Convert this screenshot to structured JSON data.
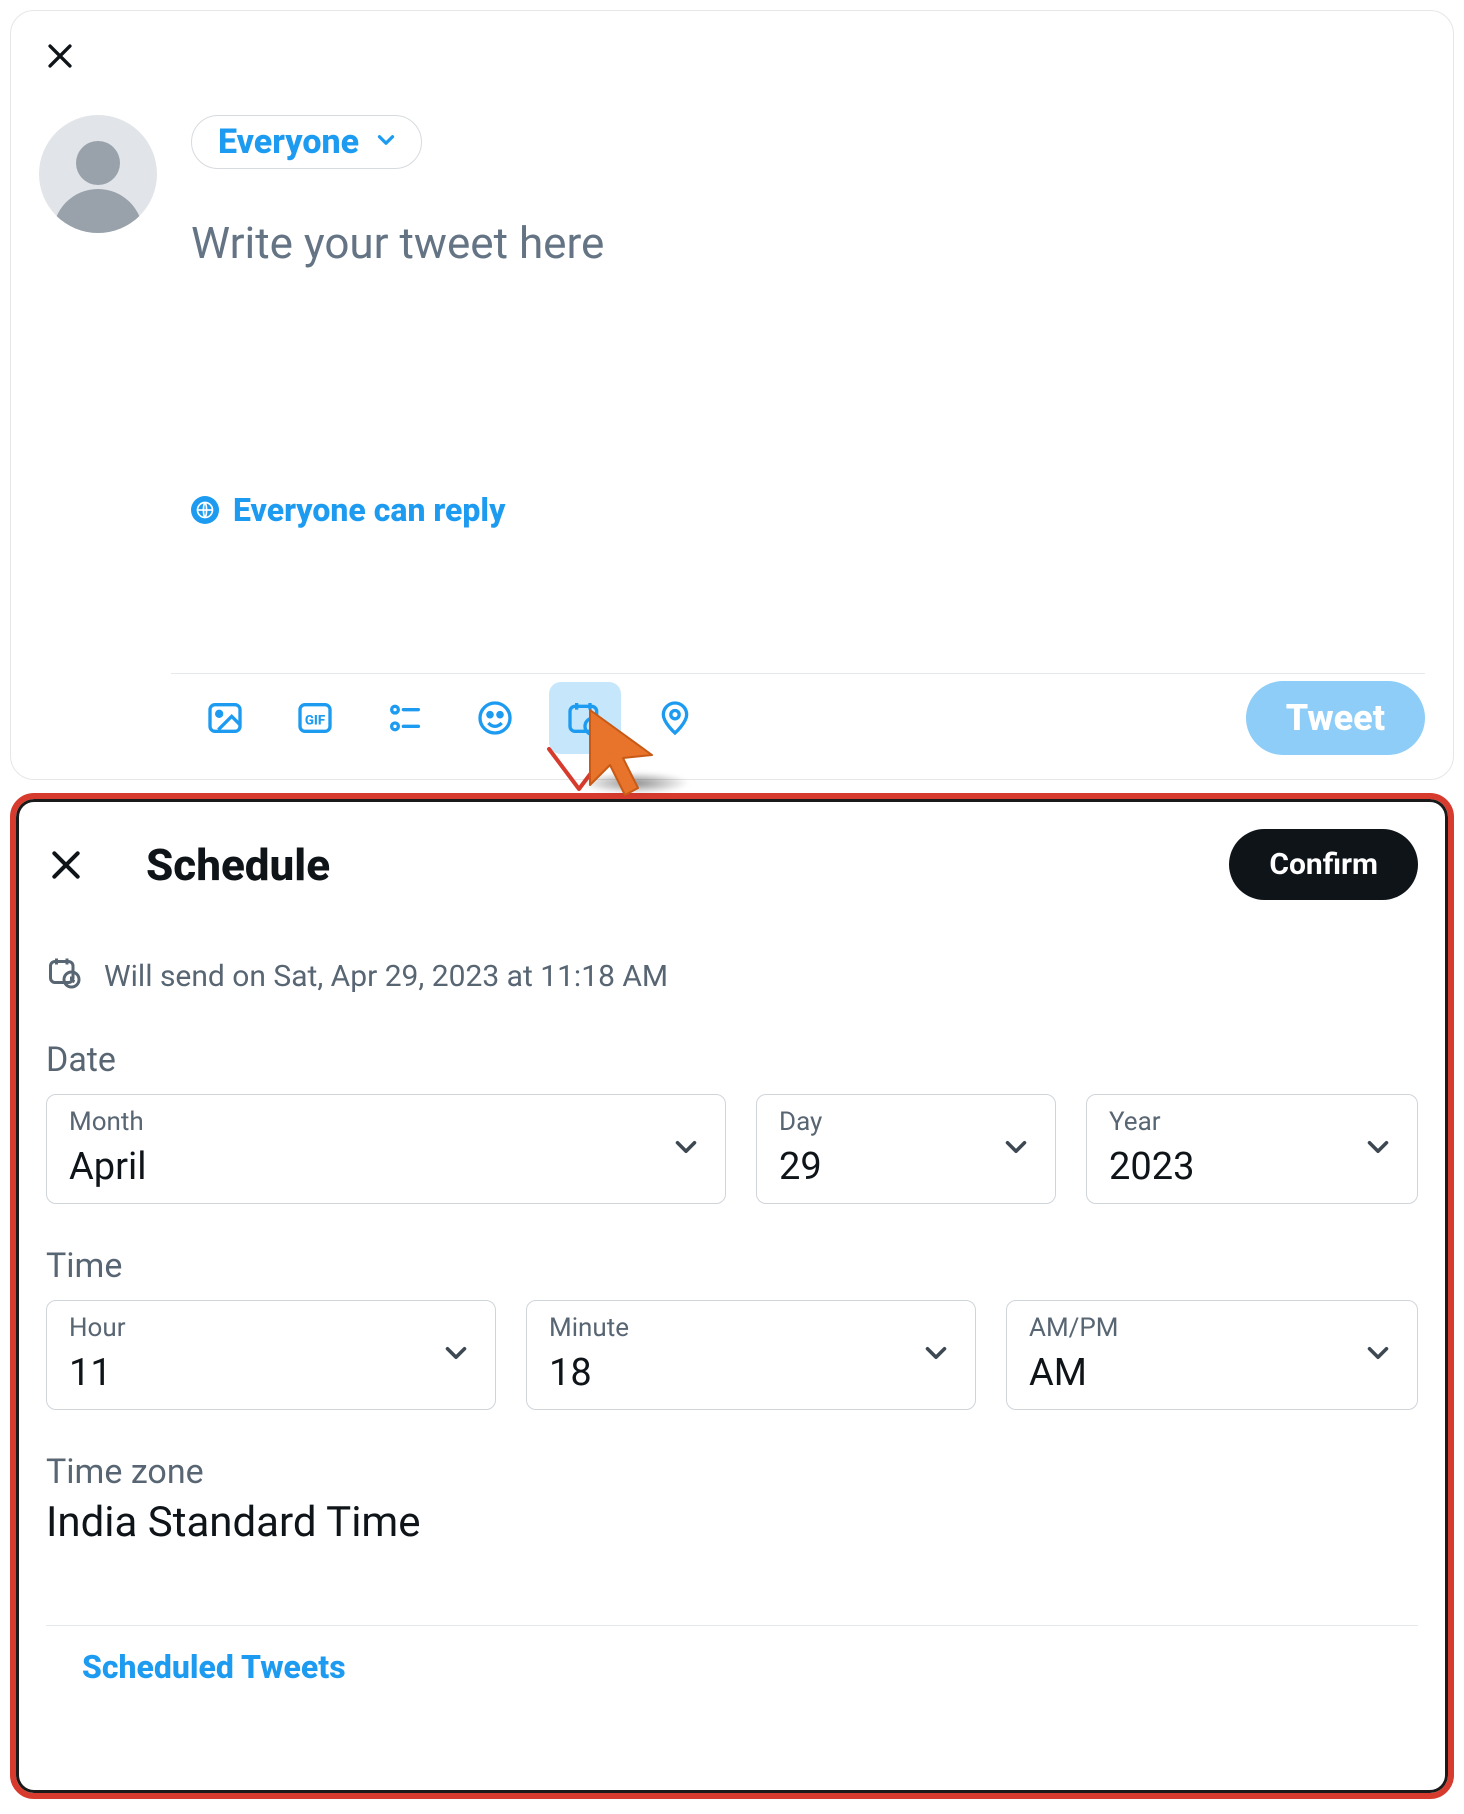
{
  "compose": {
    "audience_label": "Everyone",
    "placeholder": "Write your tweet here",
    "reply_label": "Everyone can reply",
    "tweet_button": "Tweet",
    "toolbar": {
      "image_icon": "image-icon",
      "gif_icon": "gif-icon",
      "poll_icon": "poll-icon",
      "emoji_icon": "emoji-icon",
      "schedule_icon": "schedule-icon",
      "location_icon": "location-icon"
    }
  },
  "colors": {
    "accent": "#1d9bf0",
    "tweet_button_bg": "#8ecdf7",
    "highlight_border": "#d73b2d",
    "confirm_bg": "#0f1419",
    "cursor": "#e8742c"
  },
  "schedule": {
    "title": "Schedule",
    "confirm_label": "Confirm",
    "send_note": "Will send on Sat, Apr 29, 2023 at 11:18 AM",
    "date_section": "Date",
    "month_label": "Month",
    "month_value": "April",
    "day_label": "Day",
    "day_value": "29",
    "year_label": "Year",
    "year_value": "2023",
    "time_section": "Time",
    "hour_label": "Hour",
    "hour_value": "11",
    "minute_label": "Minute",
    "minute_value": "18",
    "ampm_label": "AM/PM",
    "ampm_value": "AM",
    "tz_section": "Time zone",
    "tz_value": "India Standard Time",
    "scheduled_link": "Scheduled Tweets"
  }
}
